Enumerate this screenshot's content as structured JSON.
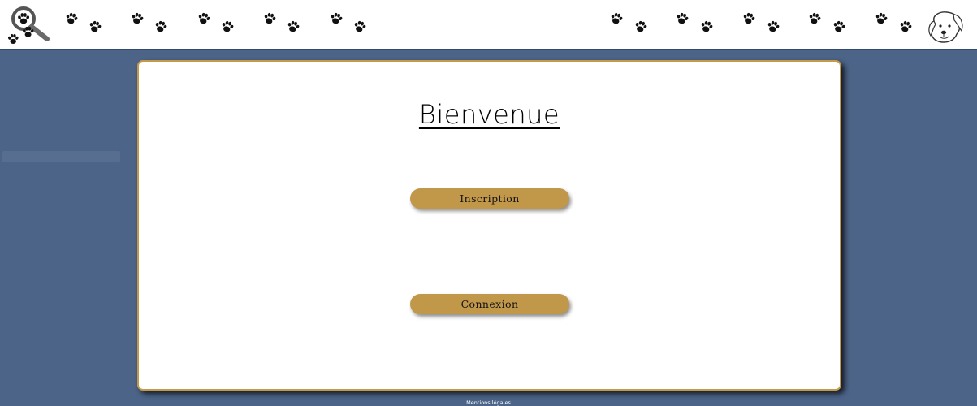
{
  "header": {
    "logo_icon": "magnifier-paw-icon",
    "mascot_icon": "dog-head-icon",
    "paw_icon": "paw-print-icon"
  },
  "main": {
    "title": "Bienvenue",
    "inscription_label": "Inscription",
    "connexion_label": "Connexion"
  },
  "footer": {
    "legal_label": "Mentions légales"
  },
  "colors": {
    "background": "#4c6488",
    "button": "#c1974a",
    "card_border": "#c49a4a"
  }
}
